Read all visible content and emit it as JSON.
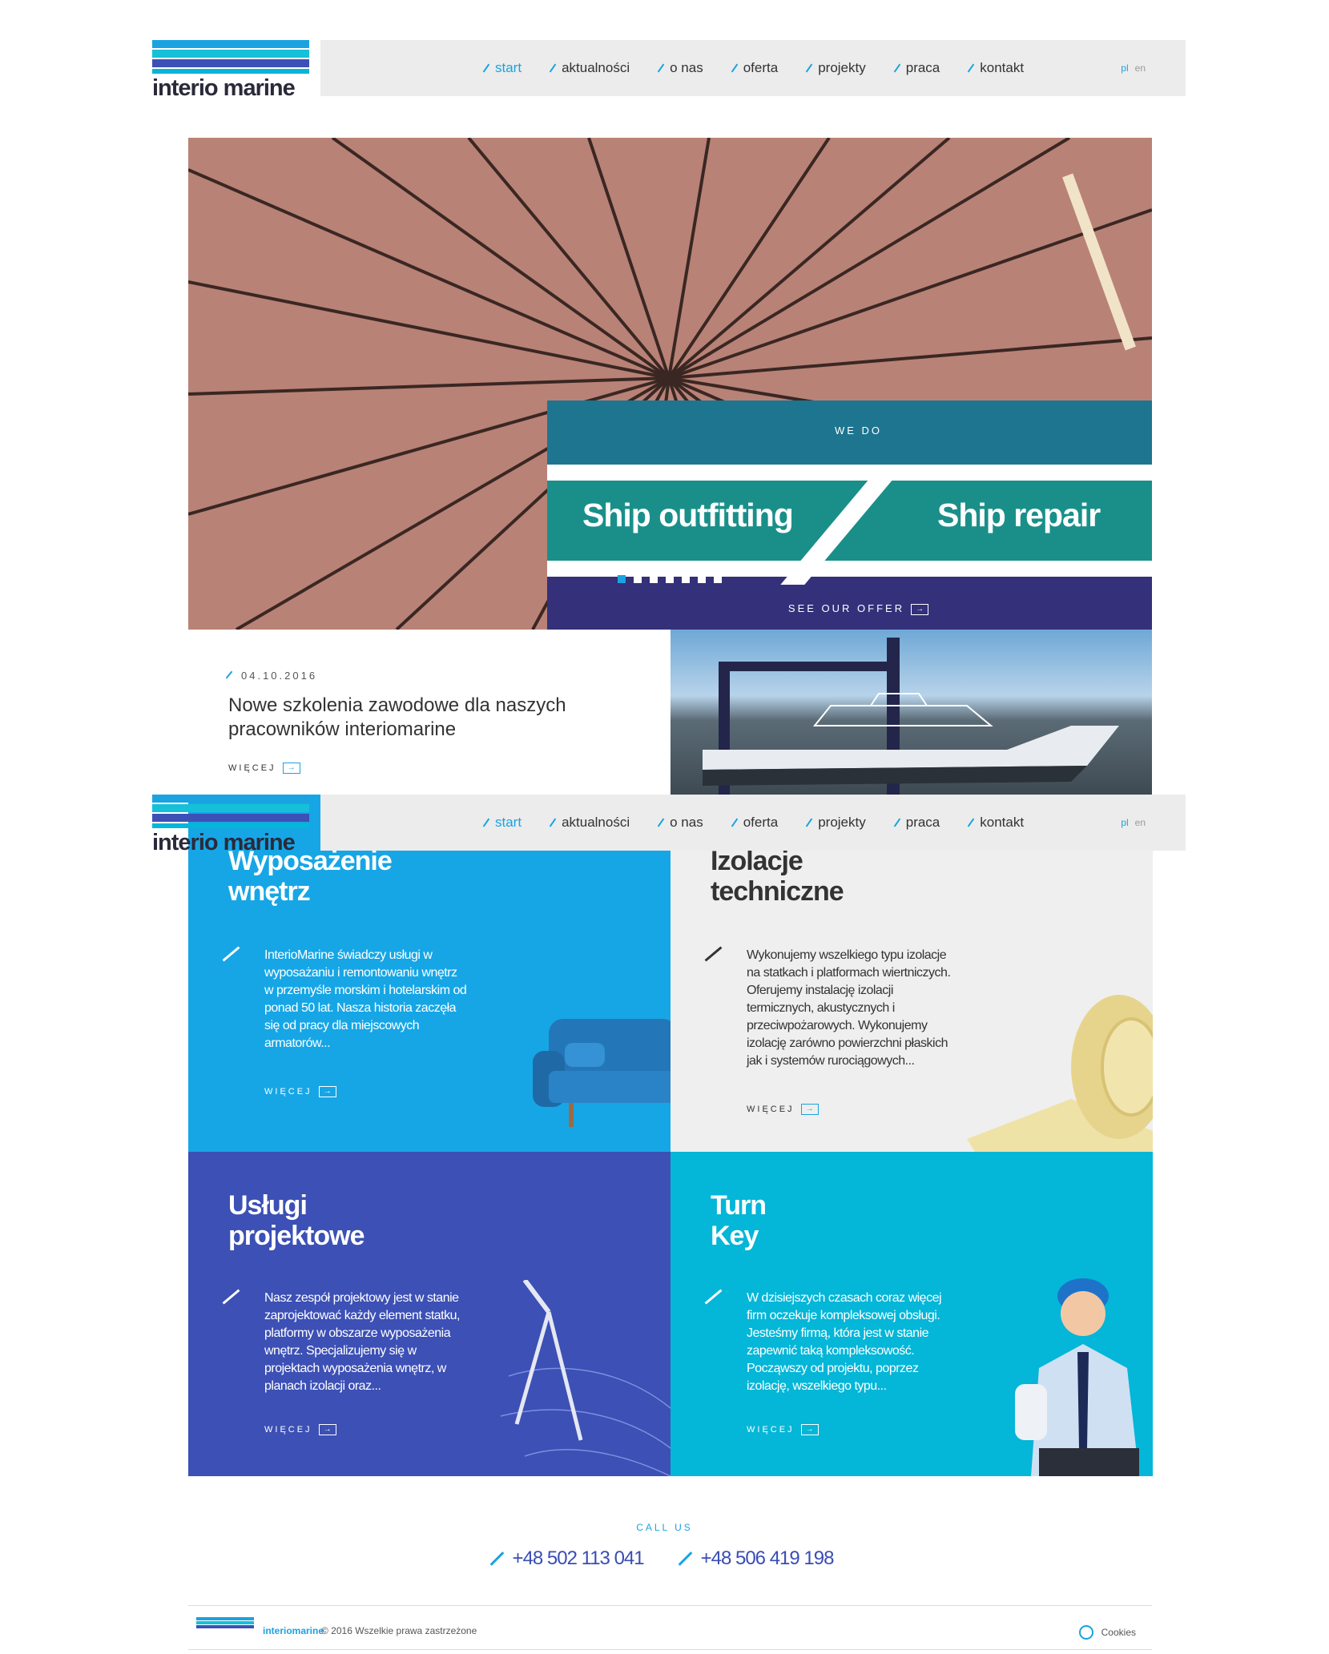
{
  "brand": {
    "name": "interio marine"
  },
  "nav": {
    "items": [
      "start",
      "aktualności",
      "o nas",
      "oferta",
      "projekty",
      "praca",
      "kontakt"
    ],
    "active": "start",
    "lang": {
      "pl": "pl",
      "en": "en"
    }
  },
  "hero": {
    "kicker": "WE DO",
    "left_title": "Ship outfitting",
    "right_title": "Ship repair",
    "cta": "SEE OUR OFFER",
    "slides": 7,
    "active_slide": 1
  },
  "news": {
    "date": "04.10.2016",
    "title": "Nowe szkolenia zawodowe dla naszych pracowników interiomarine",
    "more": "WIĘCEJ"
  },
  "services": [
    {
      "title1": "Wyposażenie",
      "title2": "wnętrz",
      "text": "InterioMarine świadczy usługi w wyposażaniu i remontowaniu wnętrz w przemyśle morskim i hotelarskim od ponad 50 lat. Nasza historia zaczęła się od pracy dla miejscowych armatorów...",
      "more": "WIĘCEJ"
    },
    {
      "title1": "Izolacje",
      "title2": "techniczne",
      "text": "Wykonujemy wszelkiego typu izolacje na statkach i platformach wiertniczych. Oferujemy instalację izolacji termicznych, akustycznych i przeciwpożarowych. Wykonujemy izolację zarówno powierzchni płaskich jak i systemów rurociągowych...",
      "more": "WIĘCEJ"
    },
    {
      "title1": "Usługi",
      "title2": "projektowe",
      "text": "Nasz zespół projektowy jest w stanie zaprojektować każdy element statku, platformy w obszarze wyposażenia wnętrz. Specjalizujemy się w projektach wyposażenia wnętrz, w planach izolacji oraz...",
      "more": "WIĘCEJ"
    },
    {
      "title1": "Turn",
      "title2": "Key",
      "text": "W dzisiejszych czasach coraz więcej firm oczekuje kompleksowej obsługi. Jesteśmy firmą, która jest w stanie zapewnić taką kompleksowość. Począwszy od projektu, poprzez izolację, wszelkiego typu...",
      "more": "WIĘCEJ"
    }
  ],
  "contact": {
    "label": "CALL US",
    "phones": [
      "+48 502 113 041",
      "+48 506 419 198"
    ]
  },
  "footer": {
    "brand": "interiomarine",
    "copy": "© 2016 Wszelkie prawa zastrzeżone",
    "cookies": "Cookies"
  },
  "icons": {
    "arrow": "arrow-right-icon",
    "pen": "slash-pen-icon",
    "cookie": "cookie-icon"
  },
  "colors": {
    "accent": "#1aa3e0",
    "blue": "#16a6e6",
    "indigo": "#3c50b5",
    "cyan": "#04b6d8",
    "navy": "#34307a",
    "teal": "#1a8f8a"
  }
}
